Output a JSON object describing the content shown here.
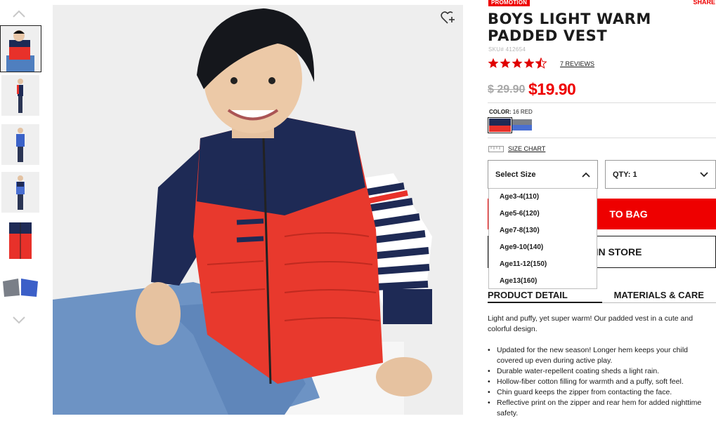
{
  "product": {
    "badge": "PROMOTION",
    "share_label": "SHARE",
    "title": "BOYS LIGHT WARM PADDED VEST",
    "sku": "SKU# 412654",
    "rating": 4.5,
    "rating_max": 5,
    "reviews_label": "7 REVIEWS",
    "old_price": "$ 29.90",
    "new_price": "$19.90"
  },
  "color": {
    "label": "COLOR:",
    "selected": "16 RED",
    "swatches": [
      {
        "name": "red-navy",
        "top": "#1e2a55",
        "bottom": "#e8312a",
        "selected": true
      },
      {
        "name": "blue-gray",
        "top": "#7a7f88",
        "bottom": "#4a6fd1",
        "selected": false
      }
    ]
  },
  "size_chart_label": "SIZE CHART",
  "size_select": {
    "value": "Select Size",
    "open": true,
    "options": [
      "Age3-4(110)",
      "Age5-6(120)",
      "Age7-8(130)",
      "Age9-10(140)",
      "Age11-12(150)",
      "Age13(160)"
    ]
  },
  "qty_select": {
    "value": "QTY: 1"
  },
  "buttons": {
    "add_to_bag": "TO BAG",
    "find_in_store": "IN STORE"
  },
  "tabs": [
    {
      "label": "PRODUCT DETAIL",
      "active": true
    },
    {
      "label": "MATERIALS & CARE",
      "active": false
    }
  ],
  "detail": {
    "intro": "Light and puffy, yet super warm! Our padded vest in a cute and colorful design.",
    "bullets": [
      "Updated for the new season! Longer hem keeps your child covered up even during active play.",
      "Durable water-repellent coating sheds a light rain.",
      "Hollow-fiber cotton filling for warmth and a puffy, soft feel.",
      "Chin guard keeps the zipper from contacting the face.",
      "Reflective print on the zipper and rear hem for added nighttime safety."
    ]
  },
  "colors": {
    "accent_red": "#ee0000",
    "star_red": "#e00000",
    "price_gray": "#a8a8a8"
  }
}
